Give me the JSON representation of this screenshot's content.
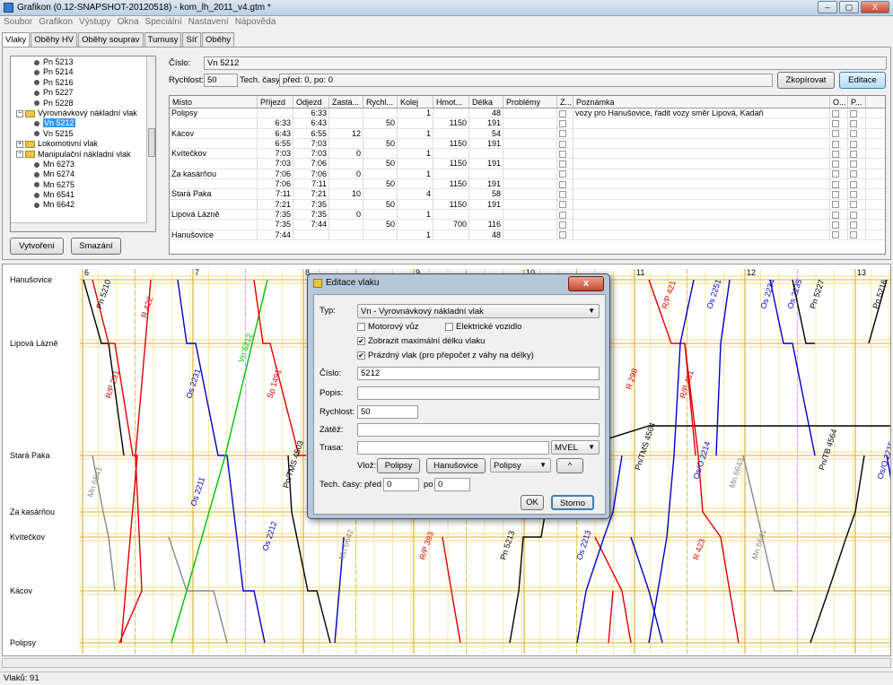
{
  "window": {
    "title": "Grafikon (0.12-SNAPSHOT-20120518) - kom_lh_2011_v4.gtm *",
    "minimize": "–",
    "maximize": "▢",
    "close": "X"
  },
  "menu": [
    "Soubor",
    "Grafikon",
    "Výstupy",
    "Okna",
    "Speciální",
    "Nastavení",
    "Nápověda"
  ],
  "tabs": [
    "Vlaky",
    "Oběhy HV",
    "Oběhy souprav",
    "Turnusy",
    "Síť",
    "Oběhy"
  ],
  "tree": [
    {
      "label": "Pn 5213",
      "kind": "train"
    },
    {
      "label": "Pn 5214",
      "kind": "train"
    },
    {
      "label": "Pn 5216",
      "kind": "train"
    },
    {
      "label": "Pn 5227",
      "kind": "train"
    },
    {
      "label": "Pn 5228",
      "kind": "train"
    },
    {
      "label": "Vyrovnávkový nákladní vlak",
      "kind": "folder-open"
    },
    {
      "label": "Vn 5212",
      "kind": "train",
      "selected": true
    },
    {
      "label": "Vn 5215",
      "kind": "train"
    },
    {
      "label": "Lokomotivní vlak",
      "kind": "folder-closed"
    },
    {
      "label": "Manipulační nákladní vlak",
      "kind": "folder-open"
    },
    {
      "label": "Mn 6273",
      "kind": "train"
    },
    {
      "label": "Mn 6274",
      "kind": "train"
    },
    {
      "label": "Mn 6275",
      "kind": "train"
    },
    {
      "label": "Mn 6541",
      "kind": "train"
    },
    {
      "label": "Mn 6642",
      "kind": "train"
    }
  ],
  "buttons": {
    "create": "Vytvoření",
    "delete": "Smazání",
    "copy": "Zkopírovat",
    "edit": "Editace"
  },
  "detail": {
    "number_label": "Číslo:",
    "number": "Vn 5212",
    "speed_label": "Rychlost:",
    "speed": "50",
    "tech_label": "Tech. časy:",
    "tech": "před: 0, po: 0"
  },
  "table": {
    "headers": [
      "Místo",
      "Příjezd",
      "Odjezd",
      "Zastá...",
      "Rychl...",
      "Kolej",
      "Hmot...",
      "Délka",
      "Problémy",
      "Z...",
      "Poznámka",
      "O...",
      "P..."
    ],
    "rows": [
      [
        "Polipsy",
        "",
        "6:33",
        "",
        "",
        "1",
        "",
        "48",
        "",
        "",
        "vozy pro Hanušovice, řadit vozy směr Lipová, Kadaň"
      ],
      [
        "",
        "6:33",
        "6:43",
        "",
        "50",
        "",
        "1150",
        "191",
        "",
        "",
        ""
      ],
      [
        "Kácov",
        "6:43",
        "6:55",
        "12",
        "",
        "1",
        "",
        "54",
        "",
        "",
        ""
      ],
      [
        "",
        "6:55",
        "7:03",
        "",
        "50",
        "",
        "1150",
        "191",
        "",
        "",
        ""
      ],
      [
        "Kvítečkov",
        "7:03",
        "7:03",
        "0",
        "",
        "1",
        "",
        "",
        "",
        "",
        ""
      ],
      [
        "",
        "7:03",
        "7:06",
        "",
        "50",
        "",
        "1150",
        "191",
        "",
        "",
        ""
      ],
      [
        "Za kasárňou",
        "7:06",
        "7:06",
        "0",
        "",
        "1",
        "",
        "",
        "",
        "",
        ""
      ],
      [
        "",
        "7:06",
        "7:11",
        "",
        "50",
        "",
        "1150",
        "191",
        "",
        "",
        ""
      ],
      [
        "Stará Paka",
        "7:11",
        "7:21",
        "10",
        "",
        "4",
        "",
        "58",
        "",
        "",
        ""
      ],
      [
        "",
        "7:21",
        "7:35",
        "",
        "50",
        "",
        "1150",
        "191",
        "",
        "",
        ""
      ],
      [
        "Lipová Lázně",
        "7:35",
        "7:35",
        "0",
        "",
        "1",
        "",
        "",
        "",
        "",
        ""
      ],
      [
        "",
        "7:35",
        "7:44",
        "",
        "50",
        "",
        "700",
        "116",
        "",
        "",
        ""
      ],
      [
        "Hanušovice",
        "7:44",
        "",
        "",
        "",
        "1",
        "",
        "48",
        "",
        "",
        ""
      ]
    ]
  },
  "graph": {
    "stations": [
      "Hanušovice",
      "Lipová Lázně",
      "Stará Paka",
      "Za kasárňou",
      "Kvítečkov",
      "Kácov",
      "Polipsy"
    ],
    "hours": [
      "6",
      "7",
      "8",
      "9",
      "10",
      "11",
      "12",
      "13"
    ],
    "train_labels": [
      {
        "t": "Pn 5210",
        "c": "#000000"
      },
      {
        "t": "R/P 291",
        "c": "#e00000"
      },
      {
        "t": "R 422",
        "c": "#e00000"
      },
      {
        "t": "Os 2231",
        "c": "#0000c8"
      },
      {
        "t": "Vn 5212",
        "c": "#00c000"
      },
      {
        "t": "Sp 1491",
        "c": "#e00000"
      },
      {
        "t": "Pn/TMS 4503",
        "c": "#000000"
      },
      {
        "t": "Mn 6541",
        "c": "#888888"
      },
      {
        "t": "Os 2211",
        "c": "#0000c8"
      },
      {
        "t": "R/P 421",
        "c": "#e00000"
      },
      {
        "t": "Os 2251",
        "c": "#0000c8"
      },
      {
        "t": "Os 2234",
        "c": "#0000c8"
      },
      {
        "t": "Os 2235",
        "c": "#0000c8"
      },
      {
        "t": "Pn 5227",
        "c": "#000000"
      },
      {
        "t": "Pn 5216",
        "c": "#000000"
      },
      {
        "t": "R/P 431",
        "c": "#e00000"
      },
      {
        "t": "R 298",
        "c": "#e00000"
      },
      {
        "t": "Pn/TMS 4504",
        "c": "#000000"
      },
      {
        "t": "Os/O 2214",
        "c": "#0000c8"
      },
      {
        "t": "Mn 6643",
        "c": "#888888"
      },
      {
        "t": "Pn/TB 4564",
        "c": "#000000"
      },
      {
        "t": "Os/O 2215",
        "c": "#0000c8"
      },
      {
        "t": "Os 2212",
        "c": "#0000c8"
      },
      {
        "t": "Mn 6642",
        "c": "#888888"
      },
      {
        "t": "R/P 393",
        "c": "#e00000"
      },
      {
        "t": "Pn 5213",
        "c": "#000000"
      },
      {
        "t": "Os 2213",
        "c": "#0000c8"
      },
      {
        "t": "R 423",
        "c": "#e00000"
      },
      {
        "t": "Mn 6641",
        "c": "#888888"
      }
    ]
  },
  "dialog": {
    "title": "Editace vlaku",
    "close": "x",
    "type_label": "Typ:",
    "type_value": "Vn - Vyrovnávkový nákladní vlak",
    "motor": "Motorový vůz",
    "electric": "Elektrické vozidlo",
    "show_max": "Zobrazit maximální délku vlaku",
    "empty": "Prázdný vlak (pro přepočet z váhy na délky)",
    "number_label": "Číslo:",
    "number": "5212",
    "desc_label": "Popis:",
    "desc": "",
    "speed_label": "Rychlost:",
    "speed": "50",
    "load_label": "Zátěž:",
    "load": "",
    "route_label": "Trasa:",
    "route": "",
    "route_combo": "MVEL",
    "insert_label": "Vlož:",
    "ins1": "Polipsy",
    "ins2": "Hanušovice",
    "ins_combo": "Polipsy",
    "up": "^",
    "tech_label": "Tech. časy:",
    "before_label": "před",
    "before": "0",
    "after_label": "po",
    "after": "0",
    "ok": "OK",
    "cancel": "Storno"
  },
  "status": "Vlaků: 91"
}
